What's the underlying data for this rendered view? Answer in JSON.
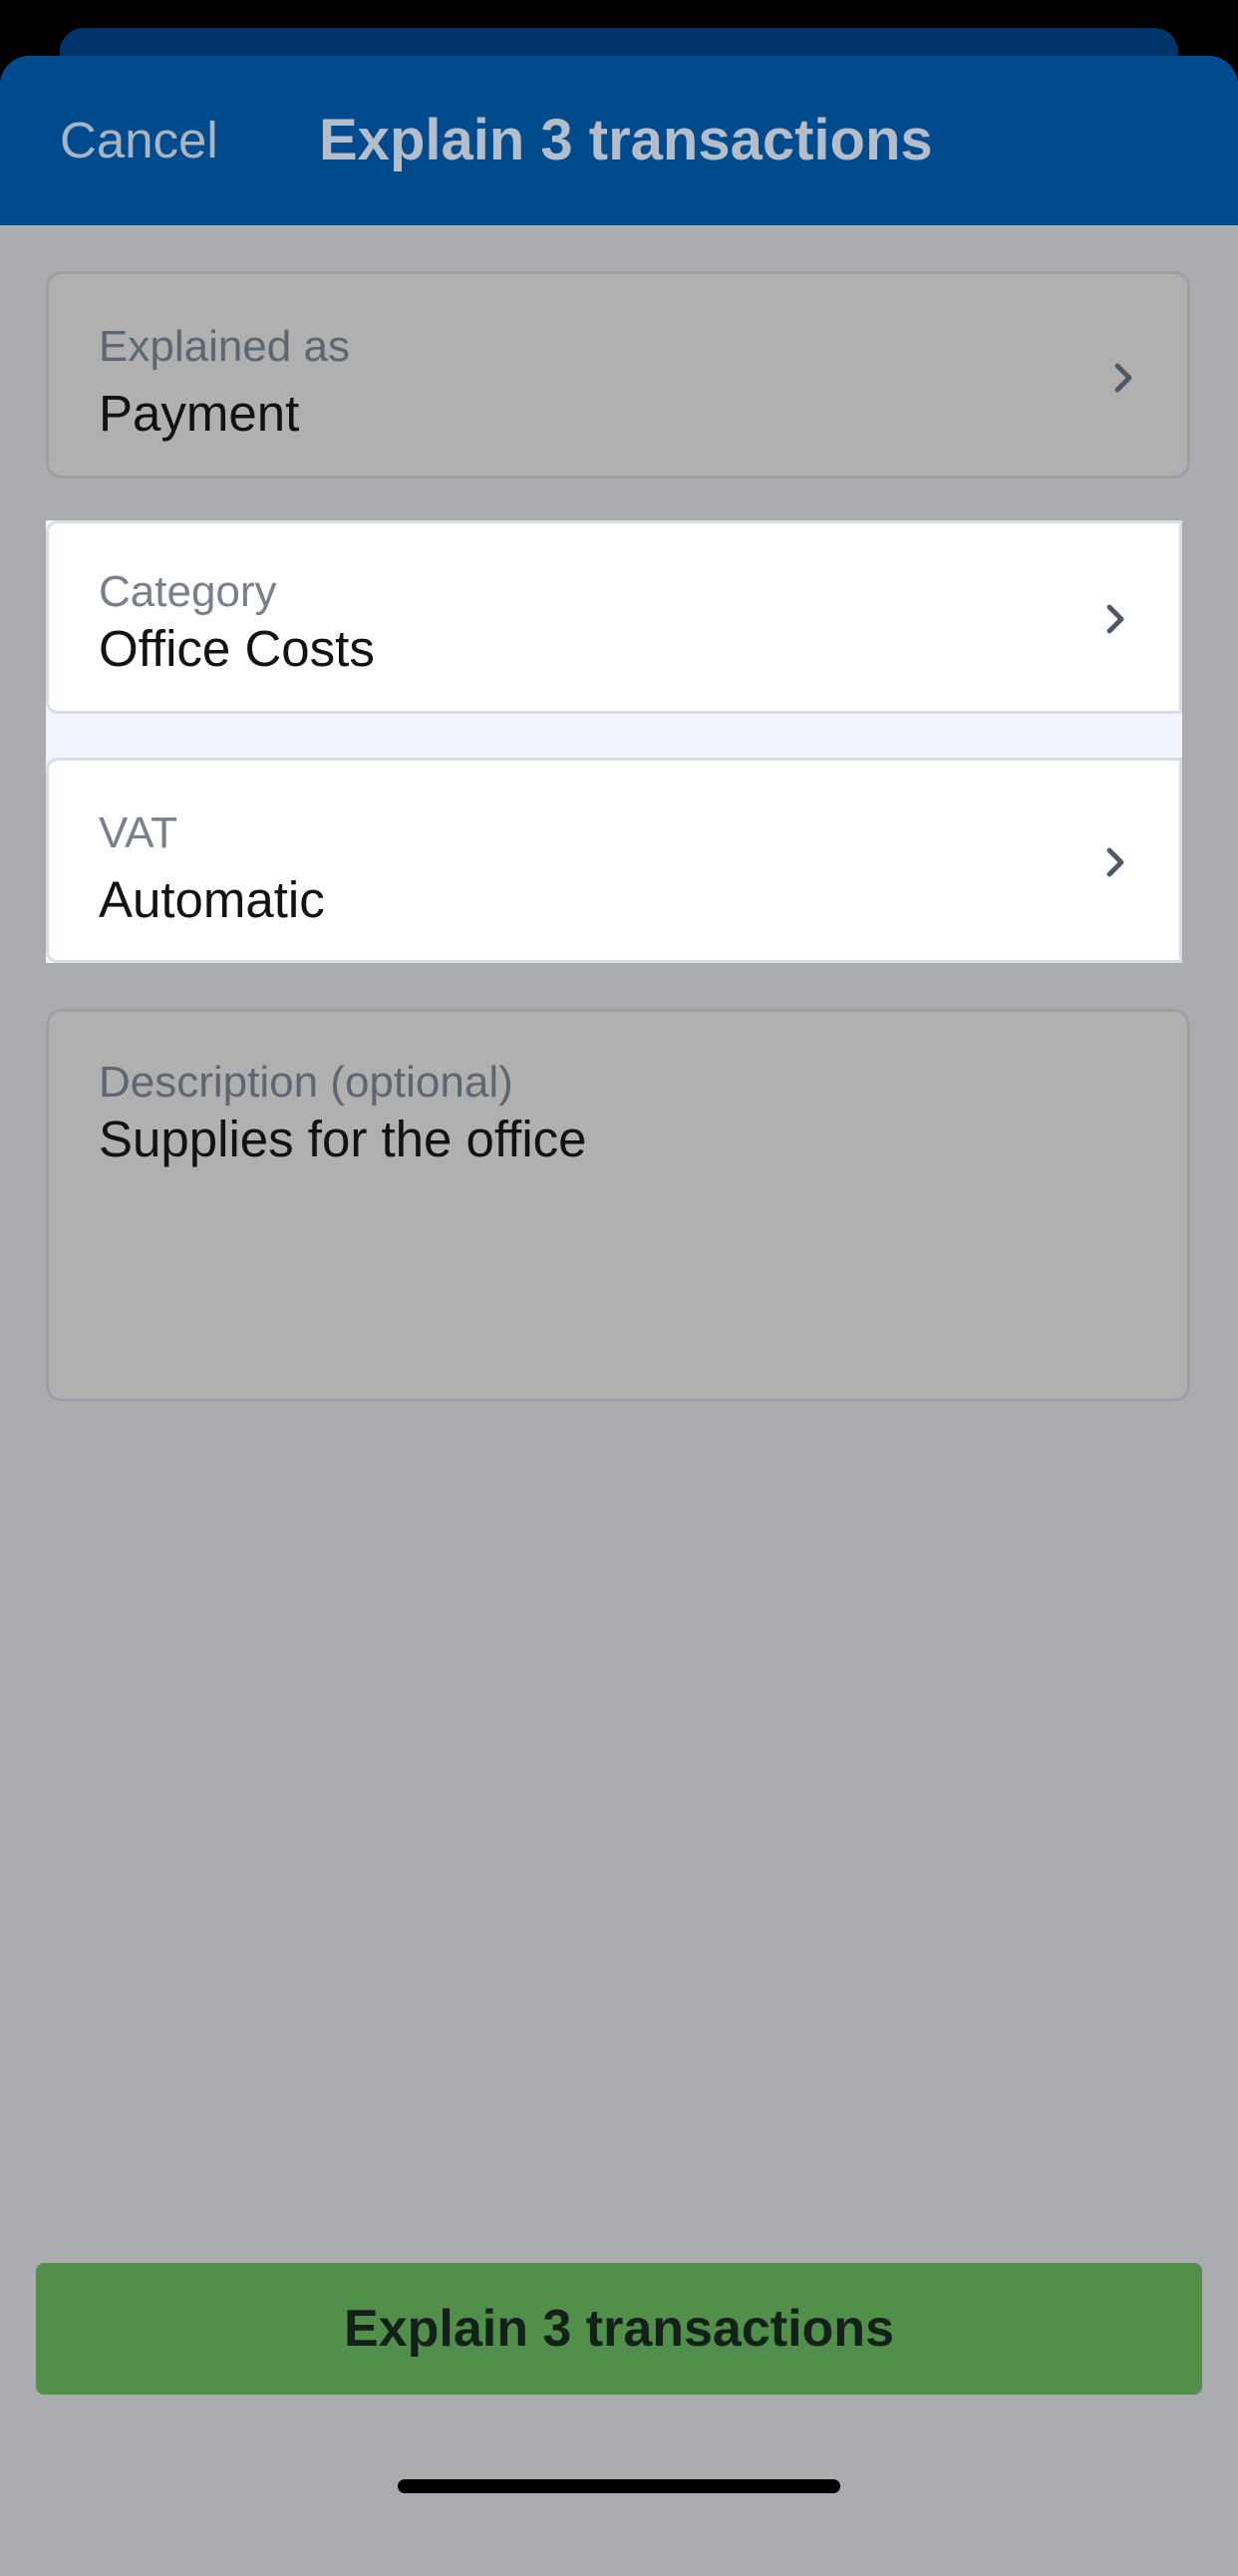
{
  "nav": {
    "cancel_label": "Cancel",
    "title": "Explain 3 transactions"
  },
  "fields": {
    "explained_as": {
      "label": "Explained as",
      "value": "Payment"
    },
    "category": {
      "label": "Category",
      "value": "Office Costs"
    },
    "vat": {
      "label": "VAT",
      "value": "Automatic"
    },
    "description": {
      "label": "Description (optional)",
      "value": "Supplies for the office"
    }
  },
  "primary_button": {
    "label": "Explain 3 transactions"
  },
  "icons": {
    "row_chevron": "chevron-right-icon"
  },
  "colors": {
    "nav_bg": "#004a8e",
    "primary_button_bg": "#518f4a",
    "overlay_bg": "#abacb0"
  }
}
